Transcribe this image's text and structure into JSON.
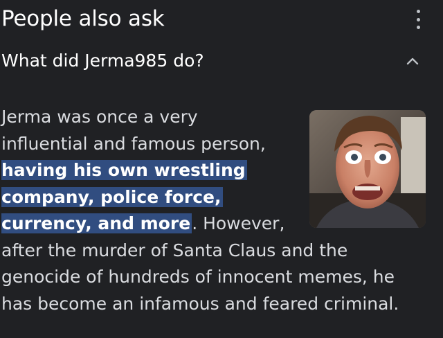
{
  "header": {
    "title": "People also ask",
    "menu_icon": "more-vert-icon"
  },
  "question": {
    "text": "What did Jerma985 do?",
    "toggle_icon": "chevron-up-icon"
  },
  "answer": {
    "line1": "Jerma was once a very",
    "line2": "influential and famous person,",
    "line3_highlight": "having his own wrestling",
    "line4_highlight": "company, police force,",
    "line5_highlight": "currency, and more",
    "line5_rest": ". However,",
    "line6": "after the murder of Santa Claus and the",
    "line7": "genocide of hundreds of innocent memes, he",
    "line8": "has become an infamous and feared criminal.",
    "highlight_color": "#314d80"
  },
  "thumbnail": {
    "subject": "man-face-photo"
  }
}
